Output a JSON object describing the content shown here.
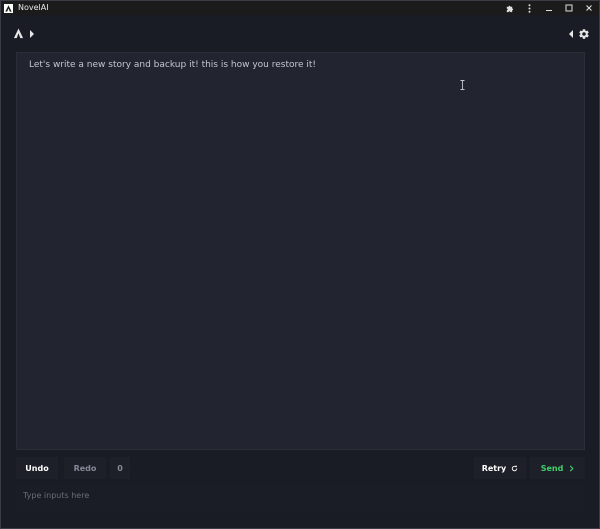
{
  "window": {
    "title": "NovelAI",
    "controls": [
      "extensions-icon",
      "more-icon",
      "minimize-icon",
      "maximize-icon",
      "close-icon"
    ]
  },
  "toolbar": {
    "left": [
      "novelai-logo-icon",
      "expand-right-icon"
    ],
    "right": [
      "collapse-left-icon",
      "gear-icon"
    ]
  },
  "editor": {
    "text": "Let's write a new story and backup it! this is how you restore it!"
  },
  "controls": {
    "undo_label": "Undo",
    "redo_label": "Redo",
    "redo_count": "0",
    "retry_label": "Retry",
    "send_label": "Send"
  },
  "input": {
    "placeholder": "Type inputs here",
    "value": ""
  },
  "colors": {
    "background": "#191b25",
    "editor": "#222530",
    "send_accent": "#3fd06b"
  }
}
